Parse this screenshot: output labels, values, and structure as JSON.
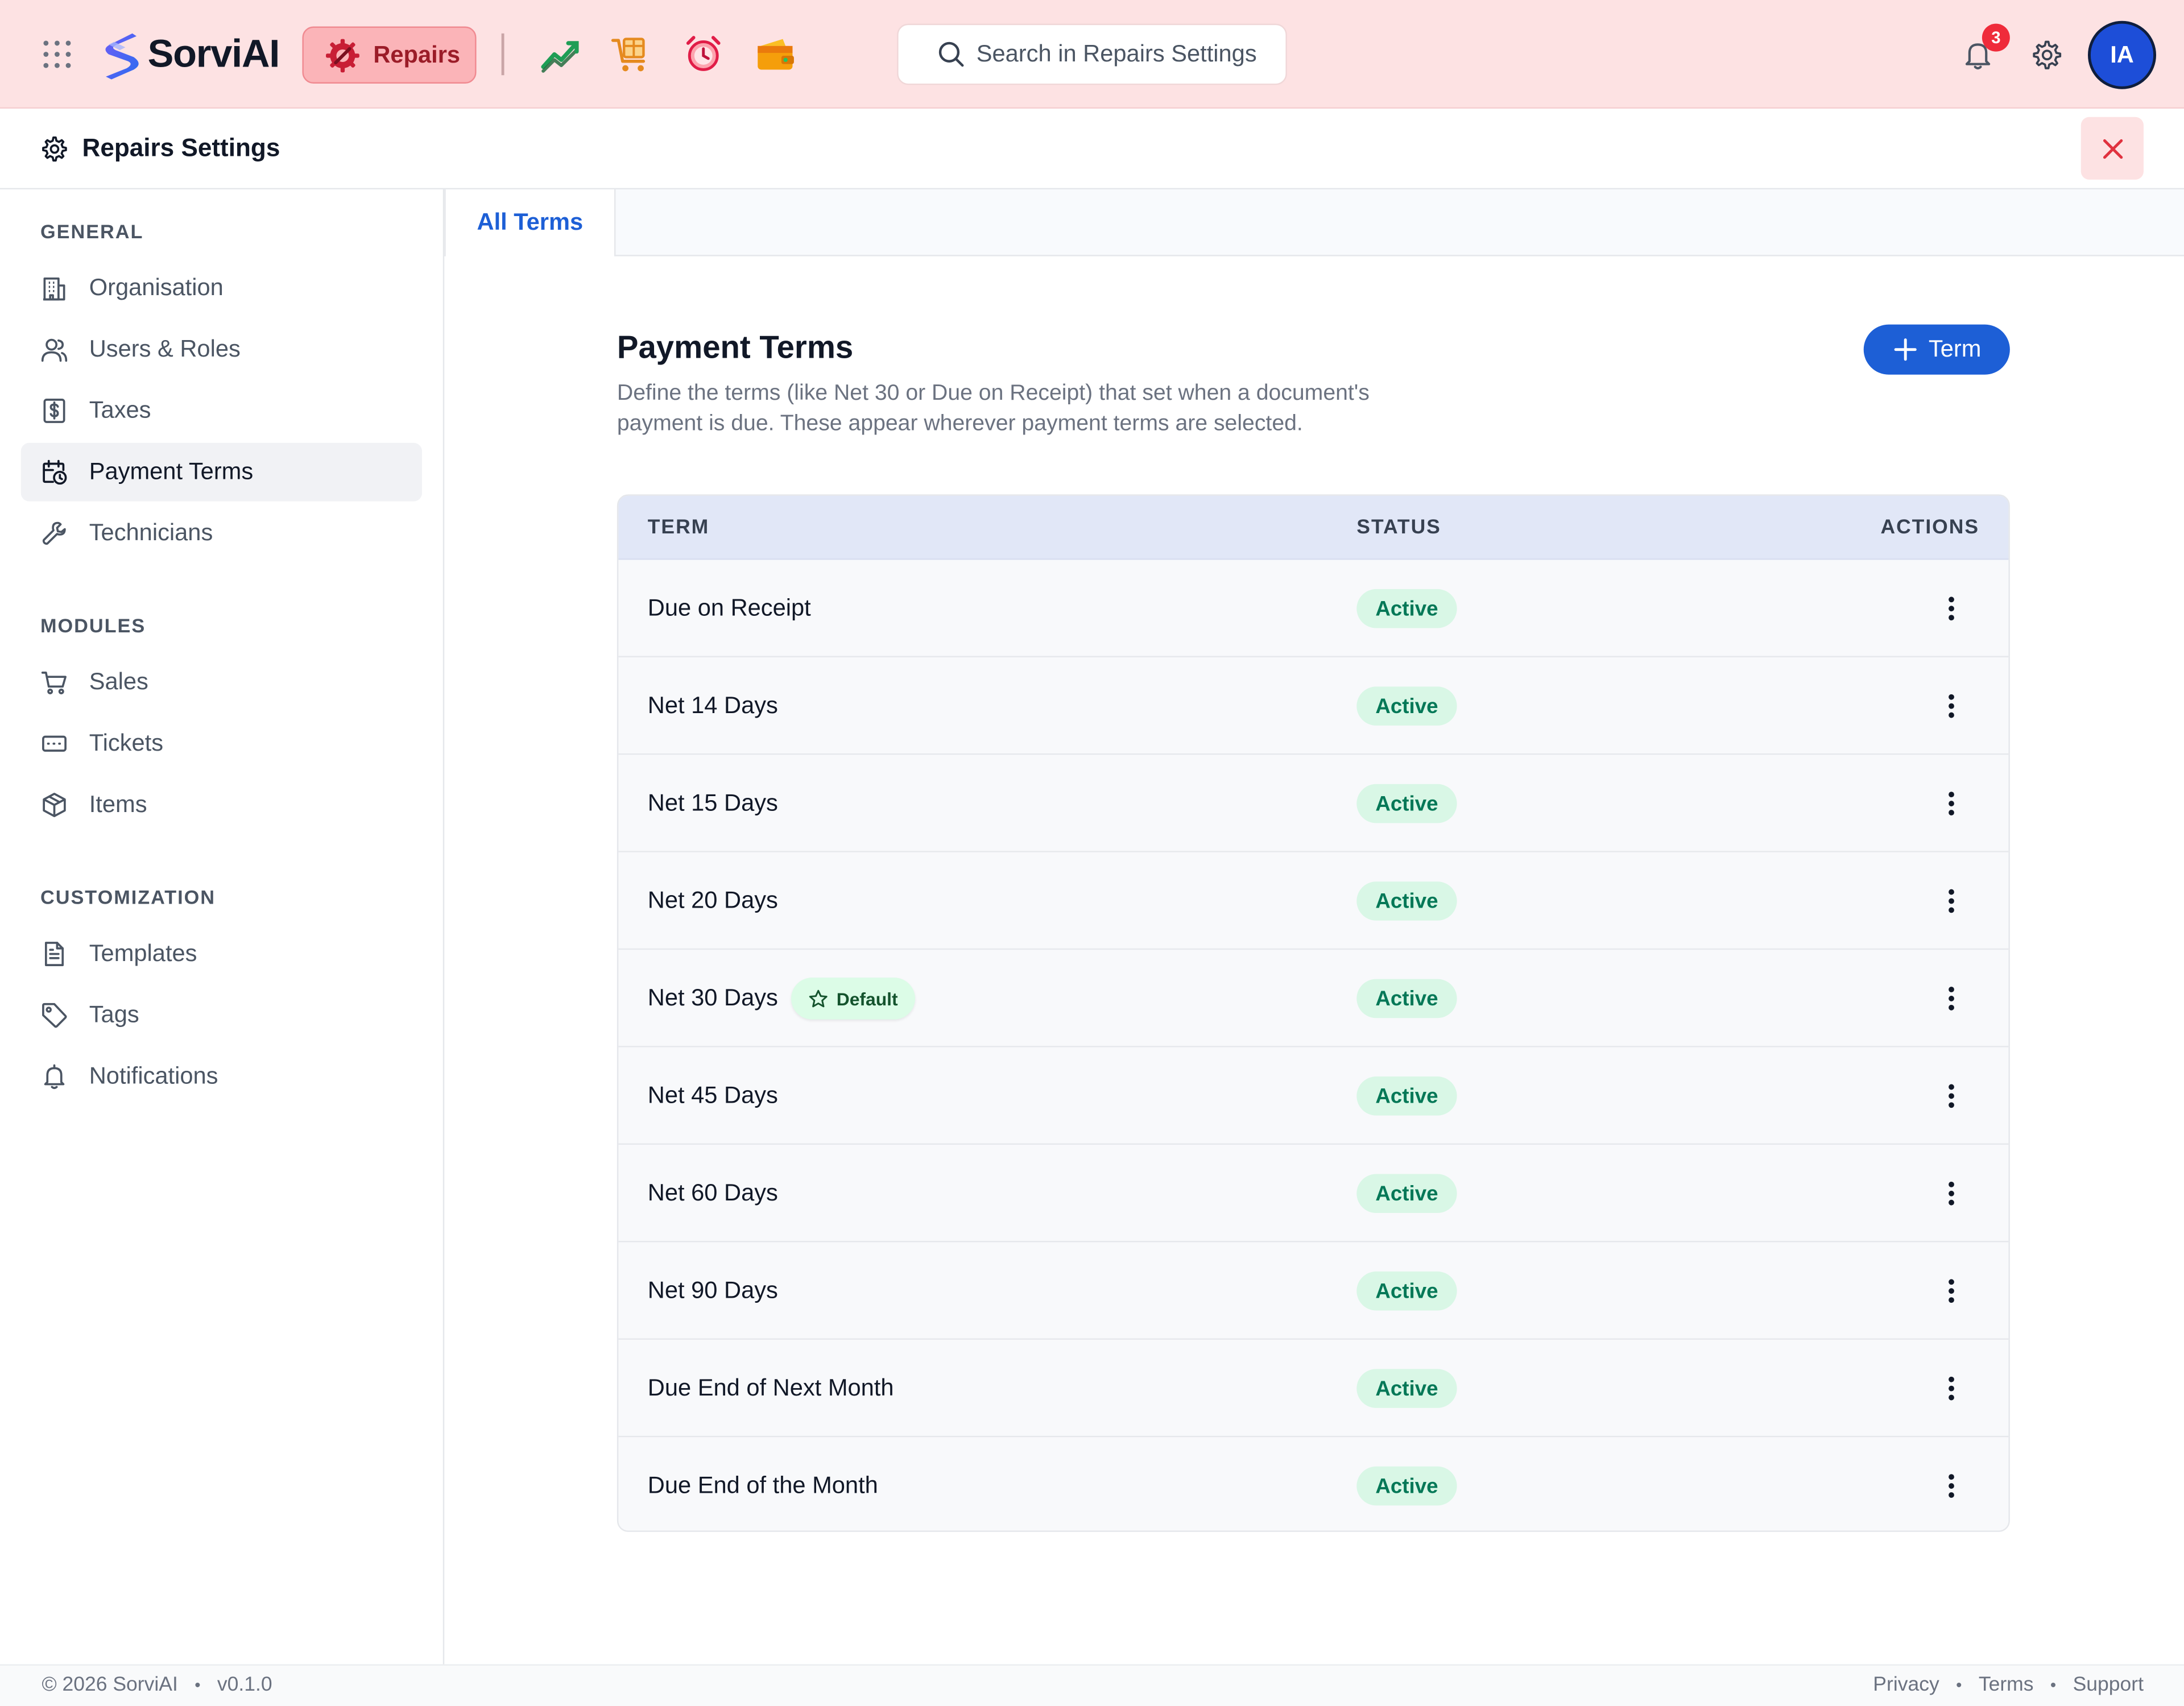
{
  "brand": {
    "name": "SorviAI",
    "module_label": "Repairs"
  },
  "header": {
    "search_placeholder": "Search in Repairs Settings",
    "notification_count": "3",
    "avatar_initials": "IA"
  },
  "settings": {
    "title": "Repairs Settings"
  },
  "sidebar": {
    "sections": [
      {
        "title": "GENERAL",
        "items": [
          {
            "label": "Organisation",
            "icon": "building-icon"
          },
          {
            "label": "Users & Roles",
            "icon": "users-icon"
          },
          {
            "label": "Taxes",
            "icon": "dollar-receipt-icon"
          },
          {
            "label": "Payment Terms",
            "icon": "calendar-clock-icon",
            "active": true
          },
          {
            "label": "Technicians",
            "icon": "wrench-icon"
          }
        ]
      },
      {
        "title": "MODULES",
        "items": [
          {
            "label": "Sales",
            "icon": "cart-icon"
          },
          {
            "label": "Tickets",
            "icon": "ticket-icon"
          },
          {
            "label": "Items",
            "icon": "box-icon"
          }
        ]
      },
      {
        "title": "CUSTOMIZATION",
        "items": [
          {
            "label": "Templates",
            "icon": "document-icon"
          },
          {
            "label": "Tags",
            "icon": "tag-icon"
          },
          {
            "label": "Notifications",
            "icon": "bell-icon"
          }
        ]
      }
    ]
  },
  "tabs": {
    "active": "All Terms"
  },
  "main": {
    "title": "Payment Terms",
    "description": "Define the terms (like Net 30 or Due on Receipt) that set when a document's payment is due. These appear wherever payment terms are selected.",
    "add_button": "Term",
    "table": {
      "headers": [
        "TERM",
        "STATUS",
        "ACTIONS"
      ],
      "default_label": "Default",
      "rows": [
        {
          "term": "Due on Receipt",
          "status": "Active",
          "default": false
        },
        {
          "term": "Net 14 Days",
          "status": "Active",
          "default": false
        },
        {
          "term": "Net 15 Days",
          "status": "Active",
          "default": false
        },
        {
          "term": "Net 20 Days",
          "status": "Active",
          "default": false
        },
        {
          "term": "Net 30 Days",
          "status": "Active",
          "default": true
        },
        {
          "term": "Net 45 Days",
          "status": "Active",
          "default": false
        },
        {
          "term": "Net 60 Days",
          "status": "Active",
          "default": false
        },
        {
          "term": "Net 90 Days",
          "status": "Active",
          "default": false
        },
        {
          "term": "Due End of Next Month",
          "status": "Active",
          "default": false
        },
        {
          "term": "Due End of the Month",
          "status": "Active",
          "default": false
        }
      ]
    }
  },
  "footer": {
    "copyright": "© 2026 SorviAI",
    "version": "v0.1.0",
    "links": [
      "Privacy",
      "Terms",
      "Support"
    ]
  },
  "colors": {
    "topbar_bg": "#fde2e3",
    "accent_blue": "#1d5fd6",
    "status_green": "#047857",
    "module_red": "#9b1c28"
  }
}
